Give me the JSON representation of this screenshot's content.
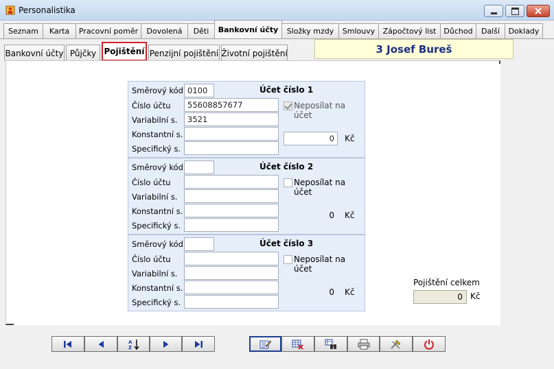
{
  "window": {
    "title": "Personalistika"
  },
  "main_tabs": [
    {
      "label": "Seznam"
    },
    {
      "label": "Karta"
    },
    {
      "label": "Pracovní poměr"
    },
    {
      "label": "Dovolená"
    },
    {
      "label": "Děti"
    },
    {
      "label": "Bankovní účty"
    },
    {
      "label": "Složky mzdy"
    },
    {
      "label": "Smlouvy"
    },
    {
      "label": "Zápočtový list"
    },
    {
      "label": "Důchod"
    },
    {
      "label": "Další"
    },
    {
      "label": "Doklady"
    }
  ],
  "sub_tabs": [
    {
      "label": "Bankovní účty"
    },
    {
      "label": "Půjčky"
    },
    {
      "label": "Pojištění"
    },
    {
      "label": "Penzijní pojištění"
    },
    {
      "label": "Životní pojištění"
    }
  ],
  "employee": {
    "name": "3 Josef Bureš"
  },
  "labels": {
    "smerovy_kod": "Směrový kód",
    "cislo_uctu": "Číslo účtu",
    "variabilni": "Variabilní s.",
    "konstantni": "Konstantní s.",
    "specificky": "Specifický s.",
    "neposilat": "Neposílat na účet",
    "currency": "Kč"
  },
  "accounts": [
    {
      "title": "Účet číslo 1",
      "smerovy_kod": "0100",
      "cislo_uctu": "55608857677",
      "variabilni": "3521",
      "konstantni": "",
      "specificky": "",
      "neposilat": true,
      "amount": "0"
    },
    {
      "title": "Účet číslo 2",
      "smerovy_kod": "",
      "cislo_uctu": "",
      "variabilni": "",
      "konstantni": "",
      "specificky": "",
      "neposilat": false,
      "amount": "0"
    },
    {
      "title": "Účet číslo 3",
      "smerovy_kod": "",
      "cislo_uctu": "",
      "variabilni": "",
      "konstantni": "",
      "specificky": "",
      "neposilat": false,
      "amount": "0"
    }
  ],
  "total": {
    "label": "Pojištění celkem",
    "value": "0",
    "unit": "Kč"
  },
  "toolbar_icons": [
    "first-record-icon",
    "previous-record-icon",
    "sort-icon",
    "next-record-icon",
    "last-record-icon",
    "edit-icon",
    "delete-icon",
    "find-icon",
    "print-icon",
    "tools-icon",
    "power-icon"
  ],
  "colors": {
    "active_subtab_border": "#d0202a",
    "name_banner_bg": "#ffffd8",
    "name_text": "#1c2f80",
    "account_bg": "#e6eefa"
  }
}
